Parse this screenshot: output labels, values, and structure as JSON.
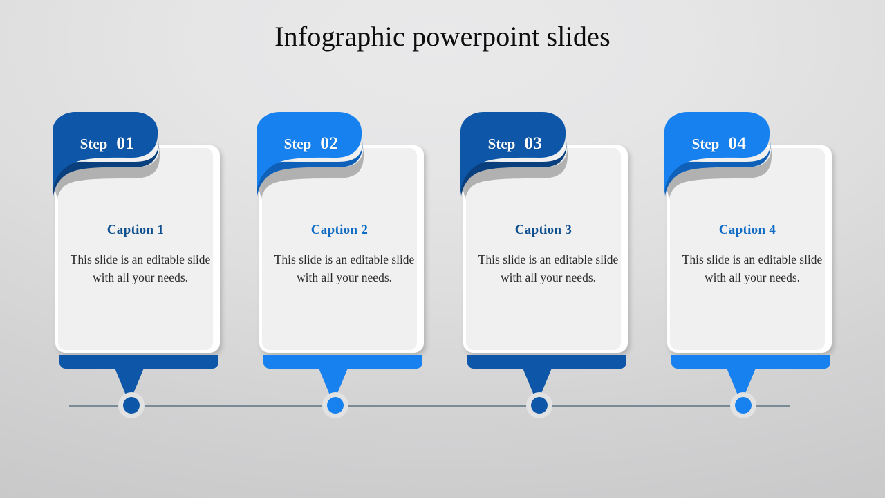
{
  "slide": {
    "title": "Infographic powerpoint slides",
    "background_top": "#e9e9ea",
    "background_bottom": "#c6c6c7",
    "timeline_color": "#7b8b95",
    "card_face": "#f0f0f0"
  },
  "steps": [
    {
      "step_label": "Step",
      "step_number": "01",
      "caption": "Caption 1",
      "body": "This slide is an editable slide with all your needs.",
      "color": "#0e57a8",
      "color_shade": "#0a3f7d",
      "caption_color": "#0e4f8f"
    },
    {
      "step_label": "Step",
      "step_number": "02",
      "caption": "Caption 2",
      "body": "This slide is an editable slide with all your needs.",
      "color": "#1681ef",
      "color_shade": "#0f60b8",
      "caption_color": "#0f6bc4"
    },
    {
      "step_label": "Step",
      "step_number": "03",
      "caption": "Caption 3",
      "body": "This slide is an editable slide with all your needs.",
      "color": "#0e57a8",
      "color_shade": "#0a3f7d",
      "caption_color": "#0e4f8f"
    },
    {
      "step_label": "Step",
      "step_number": "04",
      "caption": "Caption 4",
      "body": "This slide is an editable slide with all your needs.",
      "color": "#1681ef",
      "color_shade": "#0f60b8",
      "caption_color": "#0f6bc4"
    }
  ]
}
